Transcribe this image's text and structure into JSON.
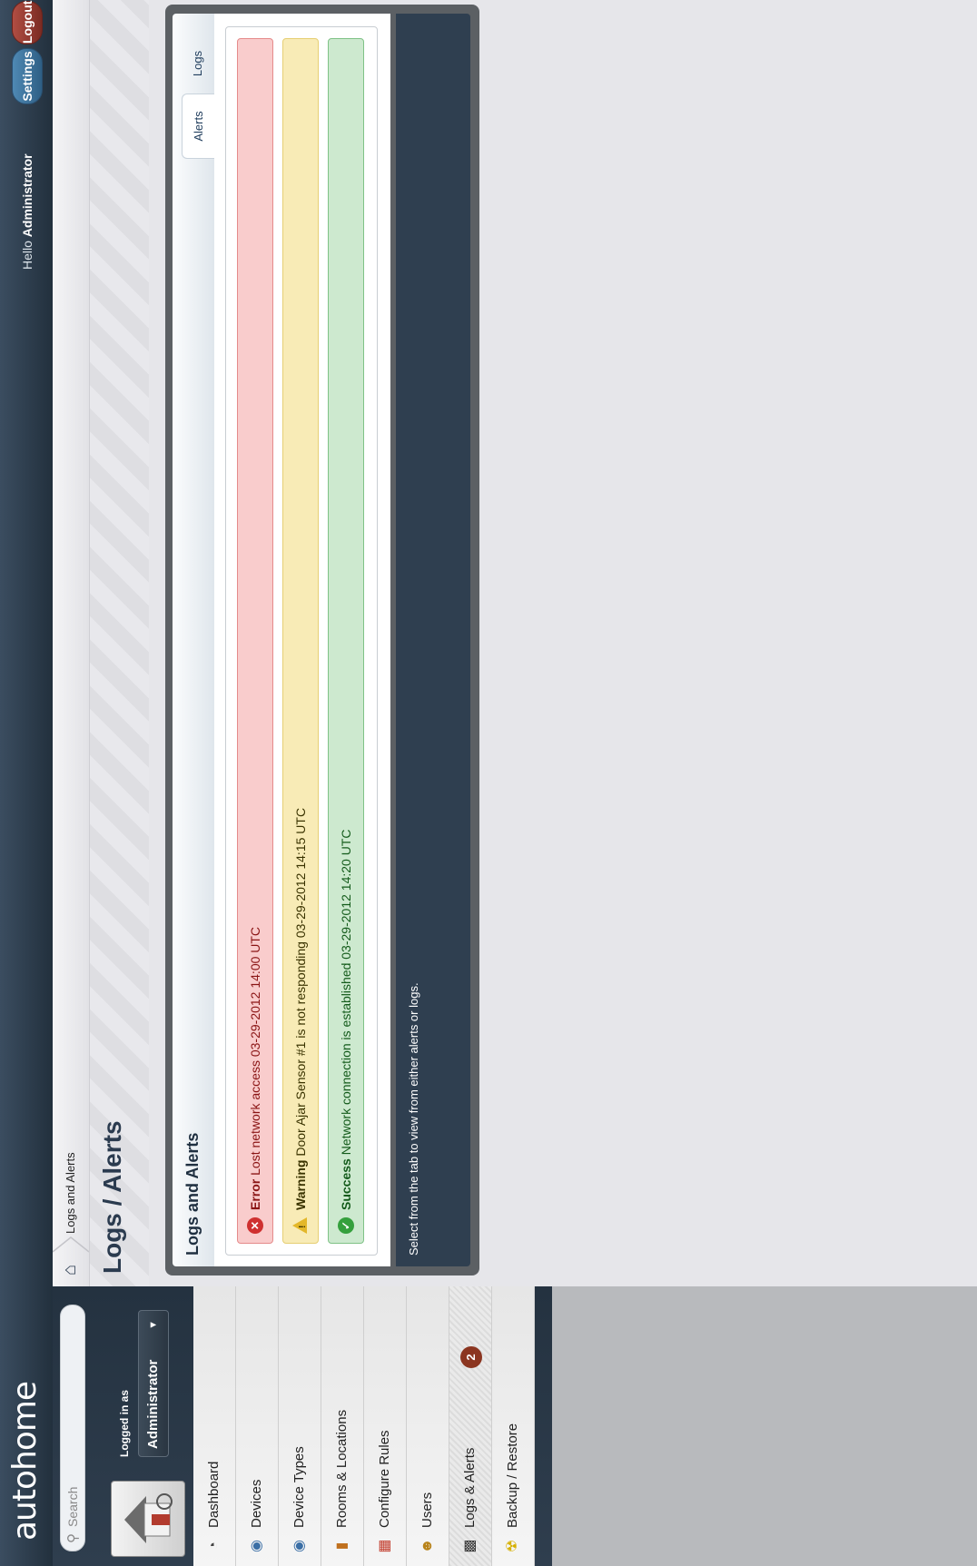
{
  "app": {
    "logo": "autohome"
  },
  "topbar": {
    "hello_prefix": "Hello",
    "user": "Administrator",
    "settings_label": "Settings",
    "logout_label": "Logout"
  },
  "sidebar": {
    "search_placeholder": "Search",
    "logged_in_label": "Logged in as",
    "user_select": "Administrator",
    "nav": [
      {
        "label": "Dashboard",
        "icon": "dashboard-icon"
      },
      {
        "label": "Devices",
        "icon": "devices-icon"
      },
      {
        "label": "Device Types",
        "icon": "device-types-icon"
      },
      {
        "label": "Rooms & Locations",
        "icon": "door-icon"
      },
      {
        "label": "Configure Rules",
        "icon": "calendar-icon"
      },
      {
        "label": "Users",
        "icon": "user-icon"
      },
      {
        "label": "Logs & Alerts",
        "icon": "logs-icon",
        "badge": "2",
        "active": true
      },
      {
        "label": "Backup / Restore",
        "icon": "radiation-icon"
      }
    ]
  },
  "breadcrumb": {
    "current": "Logs and Alerts"
  },
  "page": {
    "title": "Logs / Alerts"
  },
  "panel": {
    "title": "Logs and Alerts",
    "tabs": [
      "Alerts",
      "Logs"
    ],
    "active_tab": "Alerts",
    "alerts": [
      {
        "type": "error",
        "label": "Error",
        "message": "Lost network access 03-29-2012 14:00 UTC"
      },
      {
        "type": "warning",
        "label": "Warning",
        "message": "Door Ajar Sensor #1 is not responding 03-29-2012 14:15 UTC"
      },
      {
        "type": "success",
        "label": "Success",
        "message": "Network connection is established 03-29-2012 14:20 UTC"
      }
    ],
    "footer": "Select from the tab to view from either alerts or logs."
  },
  "colors": {
    "topbar": "#2b3a4a",
    "error": "#f9cccc",
    "warning": "#f8ebb6",
    "success": "#cde9cf",
    "badge": "#8b3520"
  }
}
